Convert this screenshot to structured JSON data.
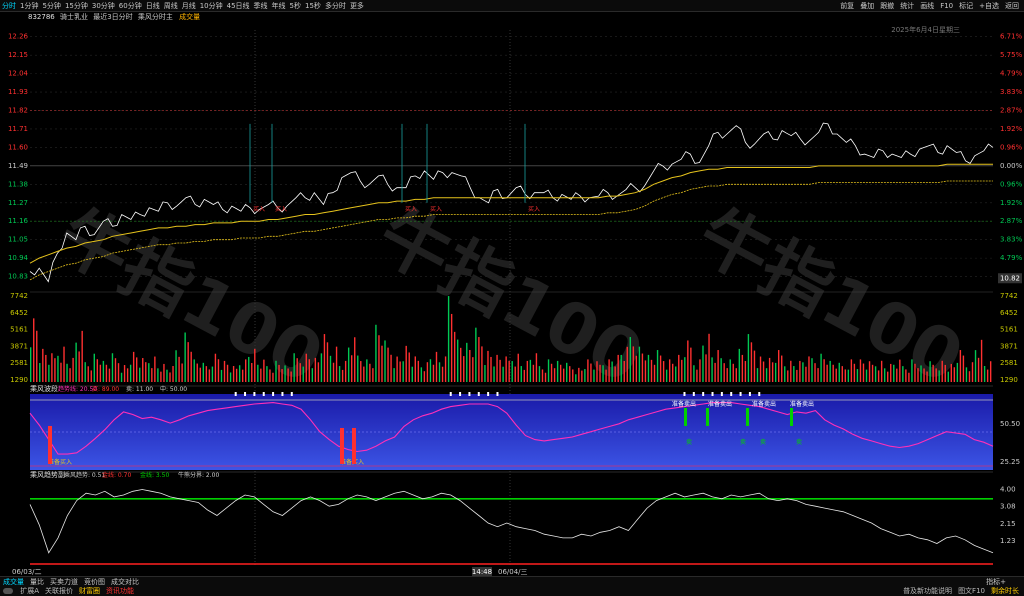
{
  "topbar": {
    "tabs": [
      "分时",
      "1分钟",
      "5分钟",
      "15分钟",
      "30分钟",
      "60分钟",
      "日线",
      "周线",
      "月线",
      "10分钟",
      "45日线",
      "季线",
      "年线",
      "5秒",
      "15秒",
      "多分时",
      "更多"
    ],
    "active_tab": 0,
    "right_tools": [
      "前复",
      "叠加",
      "跟撤",
      "统计",
      "画线",
      "F10",
      "标记",
      "+自选",
      "返回"
    ]
  },
  "info": {
    "code": "832786",
    "name": "骑士乳业",
    "period": "最近3日分时",
    "indicator": "乘风分时主",
    "volume_label": "成交量",
    "date_text": "2025年6月4日星期三"
  },
  "chart_data": {
    "type": "line",
    "price_axis": {
      "ticks": [
        "12.26",
        "12.15",
        "12.04",
        "11.93",
        "11.82",
        "11.71",
        "11.60",
        "11.49",
        "11.38",
        "11.27",
        "11.16",
        "11.05",
        "10.94",
        "10.83"
      ],
      "range": [
        10.75,
        12.3
      ],
      "prev_close": 11.49
    },
    "pct_axis": [
      "6.71%",
      "5.75%",
      "4.79%",
      "3.83%",
      "2.87%",
      "1.92%",
      "0.96%",
      "0.00%",
      "0.96%",
      "1.92%",
      "2.87%",
      "3.83%",
      "4.79%",
      "5.75%"
    ],
    "current_price": "10.82",
    "volume_axis": [
      "7742",
      "6452",
      "5161",
      "3871",
      "2581",
      "1290"
    ],
    "day_labels": [
      "06/03/二",
      "14:48",
      "06/04/三"
    ],
    "price_series": [
      10.86,
      10.88,
      10.8,
      10.97,
      11.09,
      11.05,
      11.13,
      11.08,
      11.16,
      11.13,
      11.2,
      11.17,
      11.2,
      11.24,
      11.22,
      11.27,
      11.25,
      11.3,
      11.26,
      11.29,
      11.26,
      11.23,
      11.25,
      11.22,
      11.24,
      11.23,
      11.26,
      11.24,
      11.25,
      11.3,
      11.3,
      11.33,
      11.26,
      11.33,
      11.42,
      11.45,
      11.4,
      11.38,
      11.43,
      11.38,
      11.36,
      11.36,
      11.43,
      11.46,
      11.41,
      11.45,
      11.45,
      11.43,
      11.36,
      11.3,
      11.27,
      11.35,
      11.3,
      11.36,
      11.32,
      11.33,
      11.33,
      11.3,
      11.32,
      11.29,
      11.31,
      11.3,
      11.31,
      11.33,
      11.31,
      11.35,
      11.36,
      11.37,
      11.46,
      11.49,
      11.5,
      11.53,
      11.56,
      11.51,
      11.61,
      11.69,
      11.68,
      11.73,
      11.63,
      11.62,
      11.68,
      11.65,
      11.7,
      11.67,
      11.65,
      11.64,
      11.69,
      11.74,
      11.68,
      11.63,
      11.61,
      11.56,
      11.54,
      11.58,
      11.56,
      11.54,
      11.56,
      11.59,
      11.61,
      11.57,
      11.61,
      11.57,
      11.52,
      11.55,
      11.58,
      11.6
    ],
    "vwap_series": [
      10.91,
      10.94,
      10.96,
      10.98,
      11.0,
      11.01,
      11.03,
      11.04,
      11.05,
      11.07,
      11.08,
      11.09,
      11.1,
      11.11,
      11.12,
      11.12,
      11.13,
      11.13,
      11.14,
      11.14,
      11.15,
      11.15,
      11.15,
      11.16,
      11.16,
      11.16,
      11.17,
      11.17,
      11.18,
      11.19,
      11.2,
      11.2,
      11.21,
      11.22,
      11.23,
      11.24,
      11.25,
      11.26,
      11.27,
      11.27,
      11.28,
      11.28,
      11.29,
      11.29,
      11.3,
      11.3,
      11.3,
      11.3,
      11.3,
      11.3,
      11.3,
      11.3,
      11.3,
      11.3,
      11.3,
      11.3,
      11.3,
      11.3,
      11.3,
      11.3,
      11.3,
      11.3,
      11.3,
      11.31,
      11.31,
      11.32,
      11.33,
      11.35,
      11.38,
      11.4,
      11.42,
      11.43,
      11.45,
      11.46,
      11.47,
      11.47,
      11.48,
      11.48,
      11.48,
      11.48,
      11.48,
      11.48,
      11.48,
      11.48,
      11.48,
      11.48,
      11.49,
      11.49,
      11.49,
      11.49,
      11.49,
      11.49,
      11.49,
      11.49,
      11.49,
      11.49,
      11.49,
      11.49,
      11.49,
      11.49,
      11.5,
      11.5,
      11.5,
      11.5,
      11.5,
      11.5
    ],
    "buy_signals": [
      {
        "label": "买入",
        "price": 11.27
      },
      {
        "label": "买入",
        "price": 11.27
      },
      {
        "label": "买入",
        "price": 11.26
      },
      {
        "label": "买入",
        "price": 11.27
      },
      {
        "label": "买入",
        "price": 11.27
      }
    ],
    "osc_panel": {
      "title": "乘风波段",
      "params": [
        "趋势线: 20.50",
        "买: 89.00",
        "卖: 11.00",
        "中: 50.00"
      ],
      "ticks": [
        "50.50",
        "25.25"
      ],
      "signal_labels": [
        "准备买入",
        "准备买入",
        "准备卖出",
        "准备卖出",
        "准备卖出",
        "准备卖出",
        "卖",
        "卖",
        "卖",
        "卖"
      ],
      "values": [
        80,
        62,
        40,
        18,
        18,
        20,
        30,
        42,
        55,
        70,
        82,
        78,
        72,
        74,
        70,
        65,
        70,
        76,
        80,
        84,
        86,
        88,
        90,
        92,
        94,
        95,
        96,
        94,
        92,
        86,
        70,
        52,
        40,
        30,
        25,
        22,
        24,
        30,
        38,
        44,
        60,
        70,
        76,
        80,
        86,
        90,
        92,
        94,
        94,
        94,
        90,
        80,
        62,
        46,
        40,
        38,
        40,
        42,
        44,
        48,
        52,
        56,
        60,
        64,
        70,
        74,
        78,
        82,
        86,
        88,
        90,
        92,
        94,
        96,
        96,
        96,
        94,
        92,
        90,
        86,
        82,
        78,
        82,
        80,
        84,
        70,
        62,
        56,
        48,
        42,
        38,
        34,
        30,
        28,
        30,
        34,
        40,
        46,
        52,
        50,
        48,
        40,
        36,
        30
      ]
    },
    "trend_panel": {
      "title": "乘风趋势副",
      "params": [
        "乘风趋势: 0.51",
        "金线: 0.70",
        "金线: 3.50",
        "牛熊分界: 2.00"
      ],
      "ticks": [
        "4.00",
        "3.08",
        "2.15",
        "1.23"
      ],
      "values": [
        3.2,
        2.1,
        0.6,
        1.4,
        2.6,
        3.4,
        3.8,
        3.7,
        3.9,
        3.6,
        3.7,
        3.9,
        4.0,
        3.9,
        3.8,
        3.6,
        3.5,
        3.4,
        3.3,
        2.9,
        2.6,
        3.0,
        3.4,
        3.7,
        3.6,
        3.2,
        2.8,
        2.6,
        3.0,
        3.4,
        3.6,
        3.4,
        3.1,
        3.2,
        3.5,
        3.7,
        3.6,
        3.4,
        3.6,
        3.8,
        3.9,
        3.7,
        3.5,
        3.6,
        3.8,
        3.7,
        3.4,
        3.0,
        2.6,
        2.2,
        2.0,
        2.2,
        2.0,
        1.9,
        1.8,
        1.6,
        1.5,
        1.4,
        1.4,
        1.6,
        1.5,
        1.7,
        1.8,
        2.0,
        1.8,
        2.4,
        3.0,
        3.4,
        3.6,
        3.8,
        3.6,
        3.7,
        3.8,
        3.6,
        3.5,
        3.7,
        3.6,
        3.7,
        3.8,
        3.5,
        3.4,
        3.5,
        3.4,
        3.2,
        3.1,
        3.0,
        2.9,
        2.8,
        2.6,
        2.4,
        2.2,
        1.9,
        1.7,
        1.5,
        1.6,
        1.4,
        1.3,
        1.1,
        1.4,
        1.5,
        1.3,
        1.0,
        0.8,
        0.6
      ]
    },
    "volume_series": [
      4.5,
      2.2,
      1.8,
      2.5,
      1.6,
      3.2,
      1.5,
      2.0,
      1.4,
      1.8,
      1.2,
      2.0,
      1.5,
      1.8,
      1.2,
      1.0,
      2.4,
      3.5,
      1.5,
      1.2,
      2.0,
      1.4,
      1.0,
      1.6,
      2.2,
      1.4,
      1.2,
      1.5,
      1.1,
      1.8,
      2.0,
      1.6,
      3.0,
      2.5,
      1.4,
      2.8,
      2.0,
      1.6,
      3.8,
      2.6,
      1.8,
      2.4,
      1.6,
      1.4,
      2.0,
      1.6,
      6.5,
      3.0,
      2.6,
      3.4,
      2.2,
      1.8,
      1.6,
      2.0,
      1.4,
      1.8,
      1.2,
      1.6,
      1.4,
      1.2,
      1.0,
      1.5,
      1.3,
      1.6,
      1.8,
      2.2,
      3.4,
      2.5,
      1.8,
      2.0,
      1.6,
      1.8,
      2.6,
      1.6,
      3.2,
      2.0,
      1.8,
      1.6,
      2.2,
      3.0,
      1.8,
      1.6,
      2.0,
      1.5,
      1.4,
      1.6,
      1.8,
      2.0,
      1.4,
      1.2,
      1.6,
      1.5,
      1.3,
      1.5,
      1.2,
      1.4,
      1.2,
      1.6,
      1.1,
      1.3,
      1.5,
      1.2,
      2.0,
      1.4,
      2.8,
      1.3
    ]
  },
  "bottom_tabs": [
    "成交量",
    "量比",
    "买卖力道",
    "竞价图",
    "成交对比"
  ],
  "bottom_right": "指标+",
  "status": {
    "left": [
      "扩展A",
      "关联报价",
      "财富圈",
      "资讯功能"
    ],
    "right": [
      "普及新功能说明",
      "图文F10",
      "剩余时长"
    ]
  },
  "colors": {
    "up": "#ff3030",
    "down": "#00c853",
    "price": "#ffffff",
    "vwap": "#e6c31c",
    "osc_bg_top": "#1a1aa8",
    "osc_bg_bottom": "#3c55e6",
    "osc_line": "#ff2fb8",
    "trend_green": "#00d000",
    "trend_red": "#ff2020",
    "watermark": "#3a3a3a"
  }
}
